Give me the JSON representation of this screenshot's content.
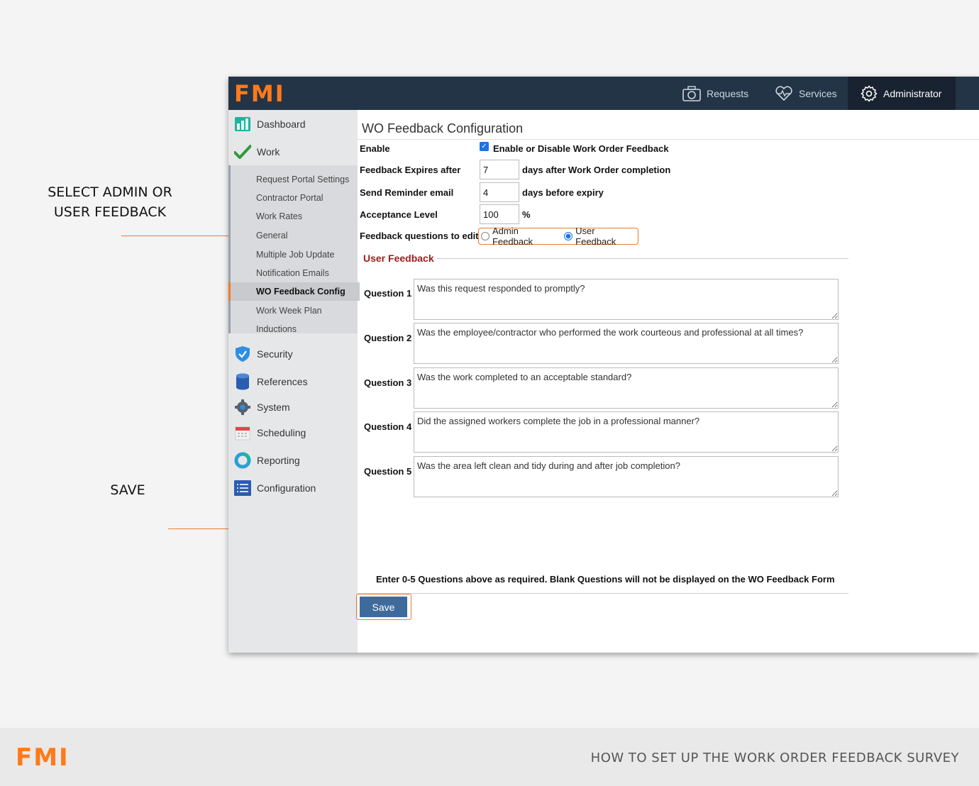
{
  "callouts": {
    "select_line1": "SELECT ADMIN OR",
    "select_line2": "USER FEEDBACK",
    "save": "SAVE"
  },
  "brand": {
    "logo": "FMI",
    "accent": "#ff7a1a",
    "topbar": "#243447"
  },
  "topnav": {
    "requests": "Requests",
    "services": "Services",
    "administrator": "Administrator"
  },
  "sidebar": {
    "items": [
      {
        "label": "Dashboard",
        "icon": "dashboard-icon"
      },
      {
        "label": "Work",
        "icon": "checkmark-icon"
      },
      {
        "label": "Security",
        "icon": "shield-icon"
      },
      {
        "label": "References",
        "icon": "database-icon"
      },
      {
        "label": "System",
        "icon": "gear-icon"
      },
      {
        "label": "Scheduling",
        "icon": "calendar-icon"
      },
      {
        "label": "Reporting",
        "icon": "donut-chart-icon"
      },
      {
        "label": "Configuration",
        "icon": "list-icon"
      }
    ],
    "work_submenu": [
      "Request Portal Settings",
      "Contractor Portal",
      "Work Rates",
      "General",
      "Multiple Job Update",
      "Notification Emails",
      "WO Feedback Config",
      "Work Week Plan",
      "Inductions"
    ]
  },
  "page": {
    "title": "WO Feedback Configuration",
    "enable_label": "Enable",
    "enable_text": "Enable or Disable Work Order Feedback",
    "expires_label": "Feedback Expires after",
    "expires_value": "7",
    "expires_text": "days after Work Order completion",
    "reminder_label": "Send Reminder email",
    "reminder_value": "4",
    "reminder_text": "days before expiry",
    "acceptance_label": "Acceptance Level",
    "acceptance_value": "100",
    "acceptance_unit": "%",
    "questions_label": "Feedback questions to edit",
    "radio_admin": "Admin Feedback",
    "radio_user": "User Feedback",
    "section_title": "User Feedback",
    "questions": [
      {
        "label": "Question 1",
        "value": "Was this request responded to promptly?"
      },
      {
        "label": "Question 2",
        "value": "Was the employee/contractor who performed the work courteous and professional at all times?"
      },
      {
        "label": "Question 3",
        "value": "Was the work completed to an acceptable standard?"
      },
      {
        "label": "Question 4",
        "value": "Did the assigned workers complete the job in a professional manner?"
      },
      {
        "label": "Question 5",
        "value": "Was the area left clean and tidy during and after job completion?"
      }
    ],
    "note": "Enter 0-5 Questions above as required. Blank Questions will not be displayed on the WO Feedback Form",
    "save": "Save"
  },
  "footer": {
    "logo": "FMI",
    "title": "HOW TO SET UP THE WORK ORDER FEEDBACK SURVEY"
  }
}
